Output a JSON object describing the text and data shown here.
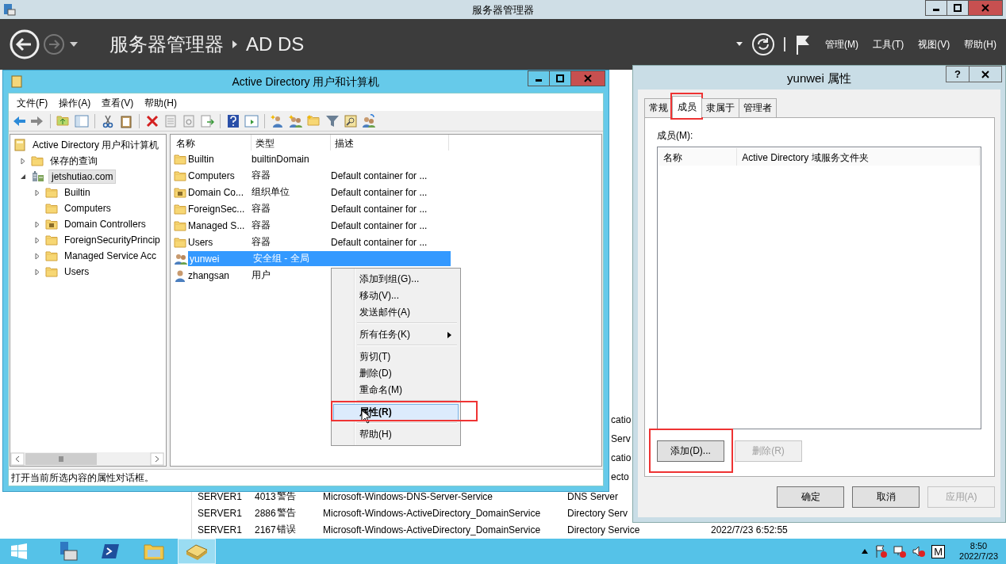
{
  "server_manager": {
    "title": "服务器管理器",
    "breadcrumb": [
      "服务器管理器",
      "AD DS"
    ],
    "menus": [
      "管理(M)",
      "工具(T)",
      "视图(V)",
      "帮助(H)"
    ],
    "partial_texts": [
      "catio",
      "Serv",
      "catio",
      "ecto"
    ],
    "events": [
      {
        "server": "SERVER1",
        "id": "4013",
        "level": "警告",
        "source": "Microsoft-Windows-DNS-Server-Service",
        "log": "DNS Server"
      },
      {
        "server": "SERVER1",
        "id": "2886",
        "level": "警告",
        "source": "Microsoft-Windows-ActiveDirectory_DomainService",
        "log": "Directory Serv"
      },
      {
        "server": "SERVER1",
        "id": "2167",
        "level": "错误",
        "source": "Microsoft-Windows-ActiveDirectory_DomainService",
        "log": "Directory Service",
        "date": "2022/7/23 6:52:55"
      }
    ]
  },
  "aduc": {
    "title": "Active Directory 用户和计算机",
    "menus": [
      "文件(F)",
      "操作(A)",
      "查看(V)",
      "帮助(H)"
    ],
    "tree": [
      {
        "label": "Active Directory 用户和计算机",
        "kind": "root",
        "selected": false,
        "children": [
          {
            "label": "保存的查询",
            "kind": "folder",
            "expandable": true,
            "expanded": false,
            "selected": false
          },
          {
            "label": "jetshutiao.com",
            "kind": "domain",
            "expandable": true,
            "expanded": true,
            "selected": true,
            "children": [
              {
                "label": "Builtin",
                "kind": "folder",
                "expandable": true,
                "expanded": false,
                "selected": false
              },
              {
                "label": "Computers",
                "kind": "folder",
                "expandable": false,
                "selected": false
              },
              {
                "label": "Domain Controllers",
                "kind": "ou",
                "expandable": true,
                "expanded": false,
                "selected": false
              },
              {
                "label": "ForeignSecurityPrincip",
                "kind": "folder",
                "expandable": true,
                "expanded": false,
                "selected": false
              },
              {
                "label": "Managed Service Acc",
                "kind": "folder",
                "expandable": true,
                "expanded": false,
                "selected": false
              },
              {
                "label": "Users",
                "kind": "folder",
                "expandable": true,
                "expanded": false,
                "selected": false
              }
            ]
          }
        ]
      }
    ],
    "list": {
      "columns": [
        "名称",
        "类型",
        "描述"
      ],
      "rows": [
        {
          "name": "Builtin",
          "type": "builtinDomain",
          "kind": "folder",
          "selected": false
        },
        {
          "name": "Computers",
          "type": "容器",
          "description": "Default container for ...",
          "kind": "folder",
          "selected": false
        },
        {
          "name": "Domain Co...",
          "type": "组织单位",
          "description": "Default container for ...",
          "kind": "ou",
          "selected": false
        },
        {
          "name": "ForeignSec...",
          "type": "容器",
          "description": "Default container for ...",
          "kind": "folder",
          "selected": false
        },
        {
          "name": "Managed S...",
          "type": "容器",
          "description": "Default container for ...",
          "kind": "folder",
          "selected": false
        },
        {
          "name": "Users",
          "type": "容器",
          "description": "Default container for ...",
          "kind": "folder",
          "selected": false
        },
        {
          "name": "yunwei",
          "type": "安全组 - 全局",
          "kind": "group",
          "selected": true
        },
        {
          "name": "zhangsan",
          "type": "用户",
          "kind": "user",
          "selected": false
        }
      ]
    },
    "status": "打开当前所选内容的属性对话框。"
  },
  "context_menu": {
    "items": [
      {
        "kind": "item",
        "label": "添加到组(G)...",
        "has_submenu": false,
        "highlighted": false,
        "default": false,
        "annotated": false
      },
      {
        "kind": "item",
        "label": "移动(V)...",
        "has_submenu": false,
        "highlighted": false,
        "default": false,
        "annotated": false
      },
      {
        "kind": "item",
        "label": "发送邮件(A)",
        "has_submenu": false,
        "highlighted": false,
        "default": false,
        "annotated": false
      },
      {
        "kind": "separator"
      },
      {
        "kind": "item",
        "label": "所有任务(K)",
        "has_submenu": true,
        "highlighted": false,
        "default": false,
        "annotated": false
      },
      {
        "kind": "separator"
      },
      {
        "kind": "item",
        "label": "剪切(T)",
        "has_submenu": false,
        "highlighted": false,
        "default": false,
        "annotated": false
      },
      {
        "kind": "item",
        "label": "删除(D)",
        "has_submenu": false,
        "highlighted": false,
        "default": false,
        "annotated": false
      },
      {
        "kind": "item",
        "label": "重命名(M)",
        "has_submenu": false,
        "highlighted": false,
        "default": false,
        "annotated": false
      },
      {
        "kind": "separator"
      },
      {
        "kind": "item",
        "label": "属性(R)",
        "has_submenu": false,
        "highlighted": true,
        "default": true,
        "annotated": true
      },
      {
        "kind": "separator"
      },
      {
        "kind": "item",
        "label": "帮助(H)",
        "has_submenu": false,
        "highlighted": false,
        "default": false,
        "annotated": false
      }
    ]
  },
  "dialog": {
    "title": "yunwei 属性",
    "help_button": "?",
    "tabs": [
      {
        "label": "常规",
        "selected": false,
        "annotated": false
      },
      {
        "label": "成员",
        "selected": true,
        "annotated": true
      },
      {
        "label": "隶属于",
        "selected": false,
        "annotated": false
      },
      {
        "label": "管理者",
        "selected": false,
        "annotated": false
      }
    ],
    "members_label": "成员(M):",
    "columns": [
      "名称",
      "Active Directory 域服务文件夹"
    ],
    "list_buttons": [
      {
        "label": "添加(D)...",
        "disabled": false,
        "annotated": true
      },
      {
        "label": "删除(R)",
        "disabled": true,
        "annotated": false
      }
    ],
    "buttons": [
      {
        "label": "确定",
        "disabled": false
      },
      {
        "label": "取消",
        "disabled": false
      },
      {
        "label": "应用(A)",
        "disabled": true
      }
    ]
  },
  "taskbar": {
    "apps": [
      {
        "kind": "server",
        "selected": false
      },
      {
        "kind": "shell",
        "selected": false
      },
      {
        "kind": "explorer",
        "selected": false
      },
      {
        "kind": "directory",
        "selected": true
      }
    ],
    "input_indicator": "M",
    "time": "8:50",
    "date": "2022/7/23"
  }
}
